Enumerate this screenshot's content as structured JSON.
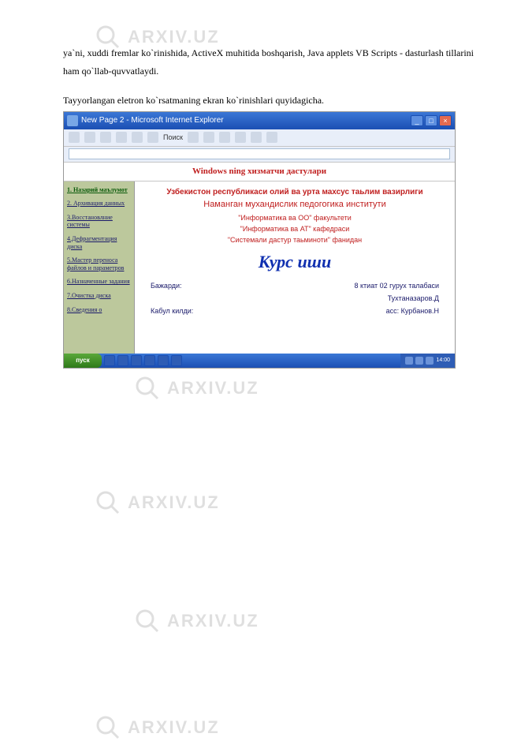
{
  "paragraphs": {
    "p1": "ya`ni, xuddi fremlar ko`rinishida, ActiveX muhitida boshqarish, Java applets VB Scripts - dasturlash tillarini ham qo`llab-quvvatlaydi.",
    "p2": "Tayyorlangan eletron ko`rsatmaning ekran ko`rinishlari quyidagicha."
  },
  "watermark": "ARXIV.UZ",
  "browser": {
    "title": "New Page 2 - Microsoft Internet Explorer",
    "toolbar_label": "Поиск",
    "address": "",
    "banner": "Windows ning хизматчи дастулари",
    "win_min": "_",
    "win_max": "□",
    "win_close": "×"
  },
  "sidebar": {
    "items": [
      "1. Назарий маълумот",
      "2. Архивация данных",
      "3.Восстановлние системы",
      "4.Дефрагментация диска",
      "5.Мастер переноса файлов и параметров",
      "6.Назначенные задания",
      "7.Очистка диска",
      "8.Сведения о"
    ]
  },
  "panel": {
    "line1": "Узбекистон республикаси олий ва урта махсус таьлим вазирлиги",
    "line2": "Наманган мухандислик педогогика институти",
    "line3": "\"Информатика ва ОО\" факультети",
    "line4": "\"Информатика ва АТ\" кафедраси",
    "line5": "\"Системали дастур таьминоти\" фанидан",
    "course_title": "Курс иши",
    "row1_left": "Бажарди:",
    "row1_right": "8 ктиат 02 гурух талабаси",
    "row2_left": "",
    "row2_right": "Тухтаназаров.Д",
    "row3_left": "Кабул килди:",
    "row3_right": "асс: Курбанов.Н"
  },
  "taskbar": {
    "start": "пуск",
    "items": [
      "",
      "",
      "",
      "",
      "",
      ""
    ],
    "time": "14:00"
  }
}
